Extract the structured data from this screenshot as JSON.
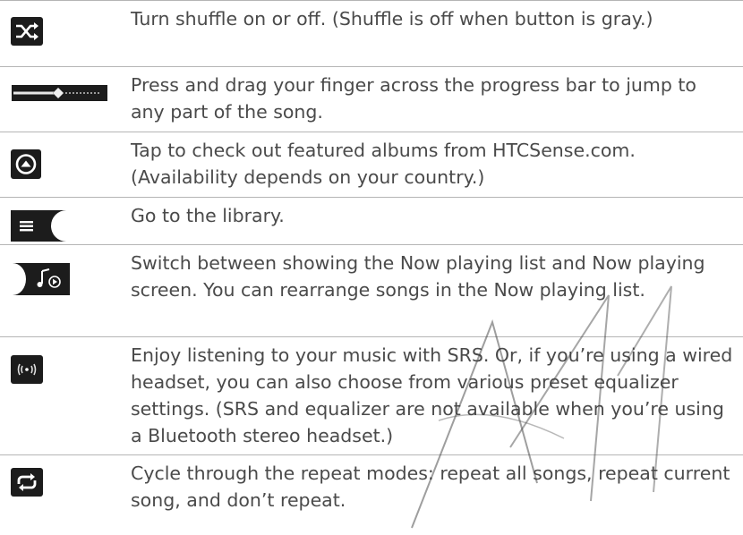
{
  "rows": [
    {
      "icon": "shuffle-icon",
      "text": "Turn shuffle on or off. (Shuffle is off when button is gray.)"
    },
    {
      "icon": "progress-bar-icon",
      "text": "Press and drag your finger across the progress bar to jump to any part of the song."
    },
    {
      "icon": "featured-albums-icon",
      "text": "Tap to check out featured albums from HTCSense.com. (Availability depends on your country.)"
    },
    {
      "icon": "library-icon",
      "text": "Go to the library."
    },
    {
      "icon": "now-playing-toggle-icon",
      "text": "Switch between showing the Now playing list and Now playing screen. You can rearrange songs in the Now playing list."
    },
    {
      "icon": "srs-icon",
      "text": "Enjoy listening to your music with SRS. Or, if you’re using a wired headset, you can also choose from various preset equalizer settings. (SRS and equalizer are not available when you’re using a Bluetooth stereo headset.)"
    },
    {
      "icon": "repeat-icon",
      "text": "Cycle through the repeat modes: repeat all songs, repeat current song, and don’t repeat."
    }
  ],
  "colors": {
    "text": "#4a4a4a",
    "rule": "#b5b5b5",
    "icon_bg": "#1c1c1c"
  }
}
